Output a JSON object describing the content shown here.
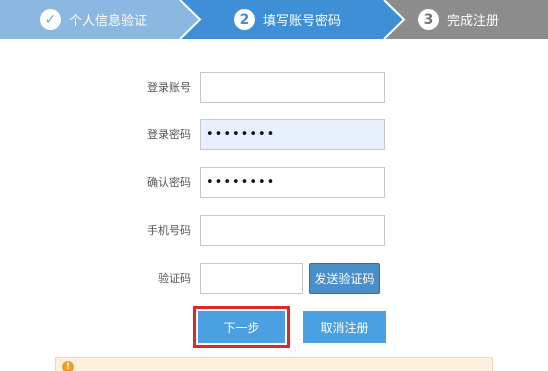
{
  "steps": [
    {
      "number": "✓",
      "label": "个人信息验证",
      "state": "done"
    },
    {
      "number": "2",
      "label": "填写账号密码",
      "state": "active"
    },
    {
      "number": "3",
      "label": "完成注册",
      "state": "pending"
    }
  ],
  "colors": {
    "step_done": "#8ab8e0",
    "step_active": "#3f8fd6",
    "step_pending": "#8c8c8c",
    "button": "#4aa0e0",
    "highlight": "#e02828"
  },
  "form": {
    "account": {
      "label": "登录账号",
      "value": ""
    },
    "password": {
      "label": "登录密码",
      "value": "••••••••"
    },
    "confirm": {
      "label": "确认密码",
      "value": "••••••••"
    },
    "phone": {
      "label": "手机号码",
      "value": ""
    },
    "code": {
      "label": "验证码",
      "value": ""
    }
  },
  "buttons": {
    "send_code": "发送验证码",
    "next": "下一步",
    "cancel": "取消注册"
  },
  "notice": {
    "icon": "warning-icon"
  }
}
